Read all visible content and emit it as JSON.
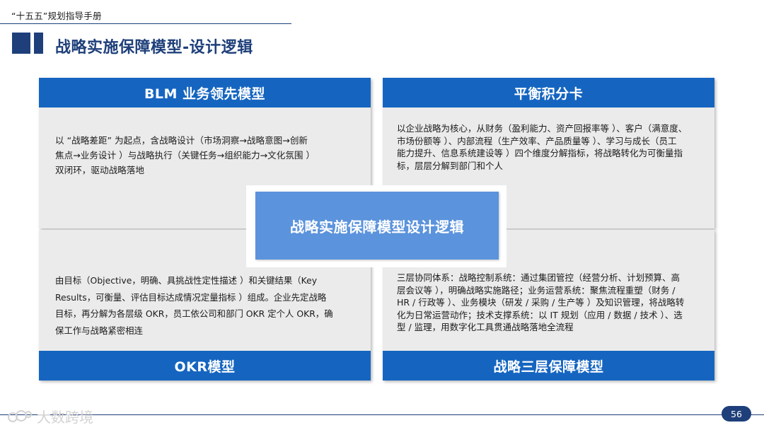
{
  "header": {
    "doc_title": "“十五五”规划指导手册"
  },
  "slide": {
    "title": "战略实施保障模型-设计逻辑"
  },
  "quadrants": {
    "top_left": {
      "heading": "BLM 业务领先模型",
      "lines": [
        "以 “战略差距” 为起点，含战略设计（市场洞察→战略意图→创新",
        "焦点→业务设计 ）与战略执行（关键任务→组织能力→文化氛围 ）",
        "双闭环，驱动战略落地"
      ]
    },
    "top_right": {
      "heading": "平衡积分卡",
      "lines": [
        "以企业战略为核心，从财务（盈利能力、资产回报率等 ）、客户（满意度、",
        "市场份额等 ）、内部流程（生产效率、产品质量等 ）、学习与成长（员工",
        "能力提升、信息系统建设等 ）四个维度分解指标，将战略转化为可衡量指",
        "标，层层分解到部门和个人"
      ]
    },
    "bottom_left": {
      "heading": "OKR模型",
      "lines": [
        "由目标（Objective，明确、具挑战性定性描述 ）和关键结果（Key",
        "Results，可衡量、评估目标达成情况定量指标 ）组成。企业先定战略",
        "目标，再分解为各层级 OKR，员工依公司和部门 OKR 定个人 OKR，确",
        "保工作与战略紧密相连"
      ]
    },
    "bottom_right": {
      "heading": "战略三层保障模型",
      "lines": [
        "三层协同体系：战略控制系统：通过集团管控（经营分析、计划预算、高",
        "层会议等 ），明确战略实施路径；业务运营系统：聚焦流程重塑（财务 /",
        "HR / 行政等 ）、业务模块（研发 / 采购 / 生产等 ）及知识管理，将战略转",
        "化为日常运营动作；技术支撑系统：以 IT 规划（应用 / 数据 / 技术 ）、选",
        "型 / 监理，用数字化工具贯通战略落地全流程"
      ]
    }
  },
  "center": {
    "label": "战略实施保障模型设计逻辑"
  },
  "footer": {
    "watermark": "大数跨境",
    "page_number": "56"
  },
  "colors": {
    "navy": "#1e3f7a",
    "header_blue": "#1565c0",
    "center_blue": "#5b93dc",
    "panel_gray": "#ebebeb"
  }
}
